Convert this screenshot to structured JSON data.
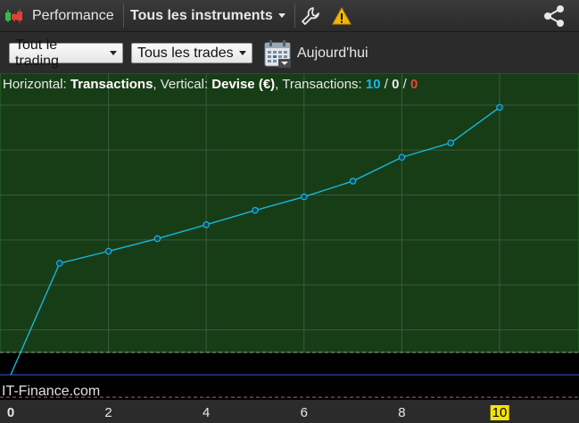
{
  "titlebar": {
    "performance_label": "Performance",
    "instrument_label": "Tous les instruments",
    "tools_icon": "wrench-icon",
    "warning_icon": "warning-icon",
    "share_icon": "share-icon"
  },
  "toolbar": {
    "trading_filter": "Tout le trading",
    "trades_filter": "Tous les trades",
    "calendar_icon": "calendar-icon",
    "date_label": "Aujourd'hui"
  },
  "info": {
    "horizontal_prefix": "Horizontal: ",
    "horizontal_value": "Transactions",
    "vertical_prefix": ", Vertical: ",
    "vertical_value": "Devise (€)",
    "transactions_prefix": ", Transactions: ",
    "count_total": "10",
    "slash1": " / ",
    "count_neutral": "0",
    "slash2": " / ",
    "count_losing": "0"
  },
  "watermark": "IT-Finance.com",
  "colors": {
    "positive_bg": "#173d17",
    "grid": "#3c5a3c",
    "line": "#19b6d8",
    "total": "#19b6e8",
    "neutral": "#e8e8e8",
    "losing": "#e8453c",
    "highlight": "#f5e400"
  },
  "chart_data": {
    "type": "line",
    "x": [
      0,
      1,
      2,
      3,
      4,
      5,
      6,
      7,
      8,
      9,
      10
    ],
    "y": [
      0,
      24.8,
      27.5,
      30.3,
      33.4,
      36.6,
      39.6,
      43.1,
      48.4,
      51.6,
      59.5
    ],
    "xlabel": "Transactions",
    "ylabel": "Devise (€)",
    "x_ticks": [
      "0",
      "2",
      "4",
      "6",
      "8",
      "10"
    ],
    "x_ticks_values": [
      0,
      2,
      4,
      6,
      8,
      10
    ],
    "highlighted_tick": "10",
    "xlim": [
      0,
      11.75
    ],
    "ylim": [
      -5.1,
      65.1
    ],
    "grid": true,
    "y_gridlines": [
      10,
      20,
      30,
      40,
      50,
      60
    ],
    "x_gridlines": [
      2,
      4,
      6,
      8,
      10
    ],
    "dashed_reference_lines": [
      5,
      -5
    ]
  }
}
